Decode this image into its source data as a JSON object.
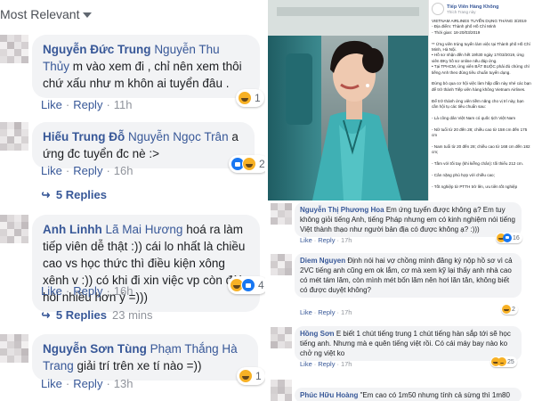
{
  "sort_label": "Most Relevant",
  "comments": [
    {
      "author": "Nguyễn Đức Trung",
      "mention": "Nguyễn Thu Thủy",
      "text": "m vào xem đi , chỉ nên xem thôi chứ xấu như m khôn ai tuyển đâu .",
      "like": "Like",
      "reply": "Reply",
      "time": "11h",
      "reactions": [
        "haha"
      ],
      "reaction_count": "1"
    },
    {
      "author": "Hiếu Trung Đỗ",
      "mention": "Nguyễn Ngọc Trân",
      "text": "a ứng đc tuyển đc nè :>",
      "like": "Like",
      "reply": "Reply",
      "time": "16h",
      "reactions": [
        "like",
        "haha"
      ],
      "reaction_count": "2",
      "replies_label": "5 Replies"
    },
    {
      "author": "Anh Linhh",
      "mention": "Lã Mai Hương",
      "text": "hoá ra làm tiếp viên dễ thật :)) cái lo nhất là chiều cao vs học thức thì điều kiện xông xênh v :)) có khi đi xin việc vp còn đòi hỏi nhiều hơn ý =)))",
      "like": "Like",
      "reply": "Reply",
      "time": "16h",
      "reactions": [
        "haha",
        "like"
      ],
      "reaction_count": "4",
      "replies_label": "5 Replies",
      "replies_time": "23 mins"
    },
    {
      "author": "Nguyễn Sơn Tùng",
      "mention": "Phạm Thắng Hà Trang",
      "text": "giải trí trên xe tí nào =))",
      "like": "Like",
      "reply": "Reply",
      "time": "13h",
      "reactions": [
        "haha"
      ],
      "reaction_count": "1"
    }
  ],
  "post": {
    "page_name": "Tiếp Viên Hàng Không",
    "page_sub": "Thích Trang này",
    "body": "VIETNAM AIRLINES TUYỂN DỤNG THÁNG 3/2019\n- Địa điểm: Thành phố Hồ Chí Minh\n- Thời gian: 18-20/03/2019\n\n** Ứng viên trúng tuyển làm việc tại Thành phố Hồ Chí Minh, Hà Nội.\n• Hồ sơ nhận đến hết 19h30 ngày 17/03/2019, ứng viên ĐKy hồ sơ online nếu đáp ứng.\n• Tại TPHCM, ứng viên BẮT BUỘC phải đủ chứng chỉ tiếng Anh theo đúng tiêu chuẩn tuyển dụng.\n\nĐừng bỏ qua cơ hội việc làm hấp dẫn này nhé các bạn để trở thành Tiếp viên hàng không Vietnam Airlines.\n\nĐể trở thành ứng viên tiềm năng cho vị trí này, bạn cần hội tụ các tiêu chuẩn sau:\n\n- Là công dân Việt Nam có quốc tịch Việt Nam\n\n- Nữ tuổi từ 20 đến 28; chiều cao từ 158 cm đến 175 cm\n\n- Nam tuổi từ 20 đến 28; chiều cao từ 168 cm đến 182 cm;\n\n- Tầm với tối tay (khi kiễng chân): tối thiểu 212 cm.\n\n- Cân nặng phù hợp với chiều cao;\n\n- Tốt nghiệp từ PTTH trở lên, ưu tiên tốt nghiệp"
  },
  "sub_comments": [
    {
      "author": "Nguyễn Thị Phương Hoa",
      "text": "Em ứng tuyển được không ạ? Em tuy không giỏi tiếng Anh, tiếng Pháp nhưng em có kinh nghiệm nói tiếng Việt thành thạo như người bản địa có được không ạ? :)))",
      "like": "Like",
      "reply": "Reply",
      "time": "17h",
      "reactions": [
        "haha",
        "like"
      ],
      "reaction_count": "16"
    },
    {
      "author": "Diem Nguyen",
      "text": "Định nói hai vợ chồng mình đăng ký nộp hồ sơ vì cả 2VC tiếng anh cũng em ok lắm, cơ mà xem kỹ lại thấy anh nhà cao có mét tám lăm, còn mình mét bốn lăm nên hơi lăn tăn, không biết có được duyệt không?",
      "like": "Like",
      "reply": "Reply",
      "time": "17h",
      "reactions": [
        "haha"
      ],
      "reaction_count": "2"
    },
    {
      "author": "Hồng Sơn",
      "text": "E biết 1 chút tiếng trung 1 chút tiếng hàn sắp tới sẽ học tiếng anh. Nhưng mà e quên tiếng việt rồi. Có cái máy bay nào ko chở ng việt ko",
      "like": "Like",
      "reply": "Reply",
      "time": "17h",
      "reactions": [
        "haha",
        "sad"
      ],
      "reaction_count": "25"
    },
    {
      "author": "Phúc Hữu Hoàng",
      "text": "\"Em cao có 1m50 nhưng tính cả sừng thì 1m80"
    }
  ]
}
